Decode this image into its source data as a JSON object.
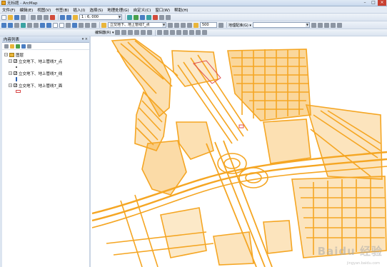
{
  "window": {
    "title": "无标题 - ArcMap"
  },
  "menu": [
    "文件(F)",
    "编辑(E)",
    "视图(V)",
    "书签(B)",
    "插入(I)",
    "选择(S)",
    "地理处理(G)",
    "自定义(C)",
    "窗口(W)",
    "帮助(H)"
  ],
  "toolbar": {
    "scale": "1 : 6, 000",
    "layer_combo": "立交地下、地上管线7_点",
    "value_combo": "500",
    "georef_label": "地理配准(G) ▾",
    "editor_label": "编辑器(R) ▾"
  },
  "toc": {
    "title": "内容列表",
    "root_label": "图层",
    "layers": [
      {
        "label": "立交地下、地上管线7_点",
        "checked": true,
        "symbol": "point"
      },
      {
        "label": "立交地下、地上管线7_线",
        "checked": true,
        "symbol": "line"
      },
      {
        "label": "立交地下、地上管线7_面",
        "checked": true,
        "symbol": "polygon"
      }
    ]
  },
  "map": {
    "feature_color": "#f5a623",
    "poly_color": "#e05050"
  },
  "watermark": {
    "text": "Baidu 经验",
    "sub": "jingyan.baidu.com"
  }
}
